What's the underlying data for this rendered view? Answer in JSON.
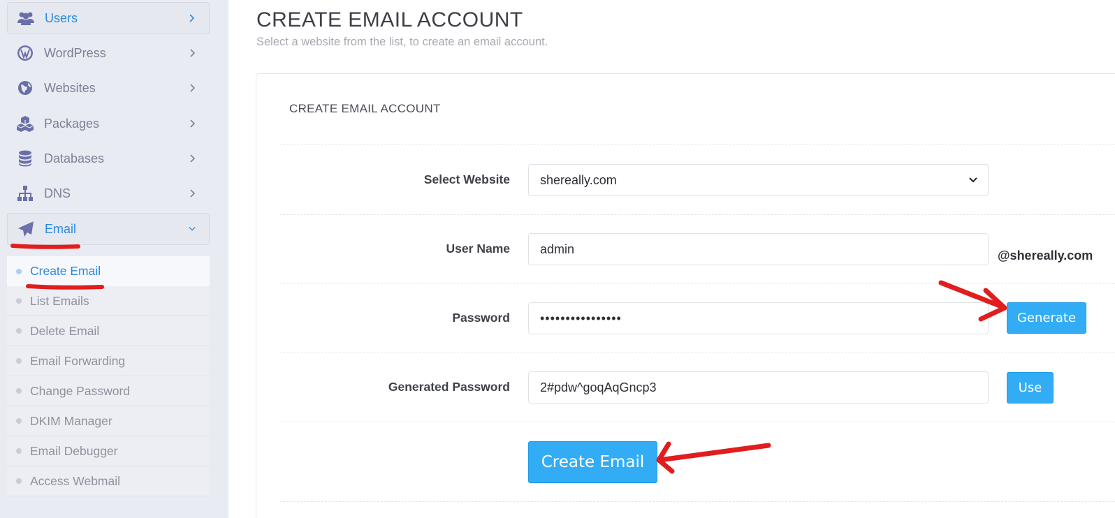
{
  "sidebar": {
    "items": [
      {
        "label": "Users",
        "icon": "users-icon"
      },
      {
        "label": "WordPress",
        "icon": "wordpress-icon"
      },
      {
        "label": "Websites",
        "icon": "globe-icon"
      },
      {
        "label": "Packages",
        "icon": "cubes-icon"
      },
      {
        "label": "Databases",
        "icon": "database-icon"
      },
      {
        "label": "DNS",
        "icon": "sitemap-icon"
      },
      {
        "label": "Email",
        "icon": "paper-plane-icon"
      }
    ],
    "email_submenu": [
      "Create Email",
      "List Emails",
      "Delete Email",
      "Email Forwarding",
      "Change Password",
      "DKIM Manager",
      "Email Debugger",
      "Access Webmail"
    ]
  },
  "header": {
    "title": "CREATE EMAIL ACCOUNT",
    "subtitle": "Select a website from the list, to create an email account."
  },
  "form": {
    "panel_title": "CREATE EMAIL ACCOUNT",
    "website_label": "Select Website",
    "website_value": "shereally.com",
    "username_label": "User Name",
    "username_value": "admin",
    "domain_suffix": "@shereally.com",
    "password_label": "Password",
    "password_value": "••••••••••••••••",
    "generate_label": "Generate",
    "generated_label": "Generated Password",
    "generated_value": "2#pdw^goqAqGncp3",
    "use_label": "Use",
    "create_label": "Create Email"
  },
  "colors": {
    "accent": "#32adf5",
    "sidebar_bg": "#e9ebf2",
    "active_link": "#2a8ae0",
    "annotation_red": "#e11d1d"
  }
}
